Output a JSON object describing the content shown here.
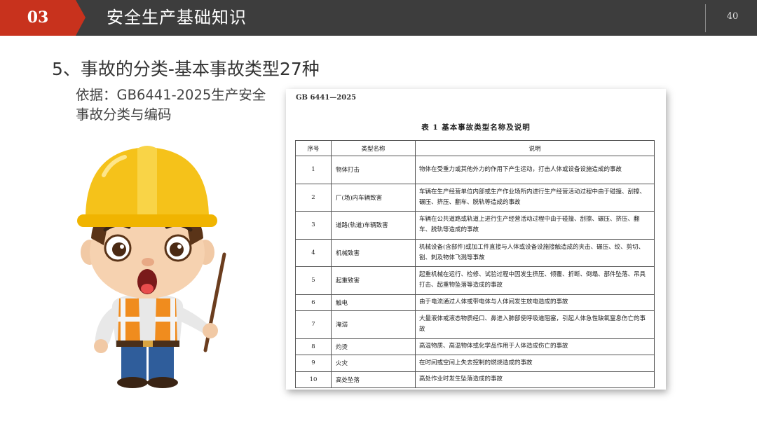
{
  "header": {
    "section_number": "03",
    "section_title": "安全生产基础知识",
    "page_number": "40"
  },
  "content": {
    "heading": "5、事故的分类-基本事故类型27种",
    "basis": "依据：GB6441-2025生产安全事故分类与编码"
  },
  "document": {
    "standard_code": "GB 6441—2025",
    "caption": "表 1   基本事故类型名称及说明",
    "columns": [
      "序号",
      "类型名称",
      "说明"
    ],
    "rows": [
      {
        "no": "1",
        "name": "物体打击",
        "desc": "物体在受重力或其他外力的作用下产生运动，打击人体或设备设施造成的事故"
      },
      {
        "no": "2",
        "name": "厂(场)内车辆致害",
        "desc": "车辆在生产经营单位内部或生产作业场所内进行生产经营活动过程中由于碰撞、刮擦、碾压、挤压、翻车、脱轨等造成的事故"
      },
      {
        "no": "3",
        "name": "道路(轨道)车辆致害",
        "desc": "车辆在公共道路或轨道上进行生产经营活动过程中由于碰撞、刮擦、碾压、挤压、翻车、脱轨等造成的事故"
      },
      {
        "no": "4",
        "name": "机械致害",
        "desc": "机械设备(含部件)或加工件直接与人体或设备设施接触造成的夹击、碾压、绞、剪切、割、刺及物体飞溅等事故"
      },
      {
        "no": "5",
        "name": "起重致害",
        "desc": "起重机械在运行、检修、试验过程中因发生挤压、倾覆、折断、倒塌、部件坠落、吊具打击、起重物坠落等造成的事故"
      },
      {
        "no": "6",
        "name": "触电",
        "desc": "由于电流通过人体或带电体与人体间发生放电造成的事故"
      },
      {
        "no": "7",
        "name": "淹溺",
        "desc": "大量液体或液态物质经口、鼻进入肺部使呼吸道阻塞，引起人体急性缺氧窒息伤亡的事故"
      },
      {
        "no": "8",
        "name": "灼烫",
        "desc": "高温物质、高温物体或化学品作用于人体造成伤亡的事故"
      },
      {
        "no": "9",
        "name": "火灾",
        "desc": "在时间或空间上失去控制的燃烧造成的事故"
      },
      {
        "no": "10",
        "name": "高处坠落",
        "desc": "高处作业时发生坠落造成的事故"
      }
    ]
  },
  "colors": {
    "header_bg": "#3d3d3d",
    "accent_red": "#c8321d",
    "helmet_yellow": "#f5c21a",
    "vest_orange": "#f08c1e"
  },
  "icons": {
    "character": "construction-worker-illustration"
  }
}
